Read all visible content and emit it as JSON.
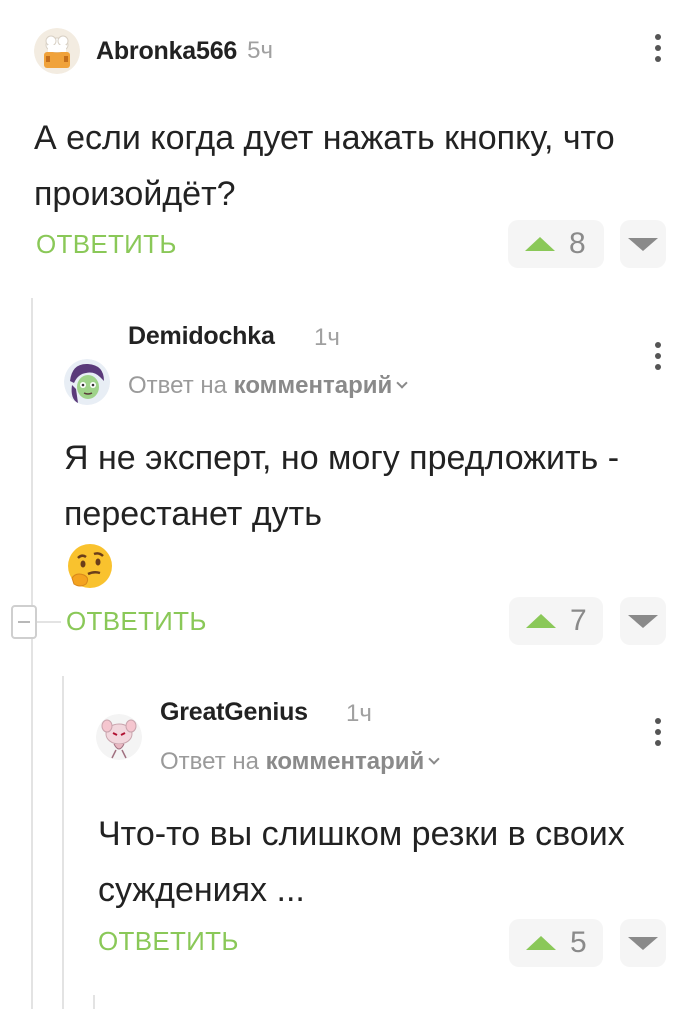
{
  "comments": [
    {
      "username": "Abronka566",
      "time": "5ч",
      "text": "А если когда дует нажать кнопку, что произойдёт?",
      "reply_label": "ОТВЕТИТЬ",
      "votes": "8",
      "avatar_icon": "chef-hat-avatar-icon"
    },
    {
      "username": "Demidochka",
      "time": "1ч",
      "reply_prefix": "Ответ на",
      "reply_target": "комментарий",
      "text": "Я не эксперт, но могу предложить - перестанет дуть",
      "emoji": "thinking-face-emoji",
      "reply_label": "ОТВЕТИТЬ",
      "votes": "7"
    },
    {
      "username": "GreatGenius",
      "time": "1ч",
      "reply_prefix": "Ответ на",
      "reply_target": "комментарий",
      "text": "Что-то вы слишком резки в своих суждениях ...",
      "reply_label": "ОТВЕТИТЬ",
      "votes": "5"
    }
  ],
  "colors": {
    "accent": "#8ac858",
    "muted": "#9a9a9a",
    "divider": "#e3e3e3"
  }
}
